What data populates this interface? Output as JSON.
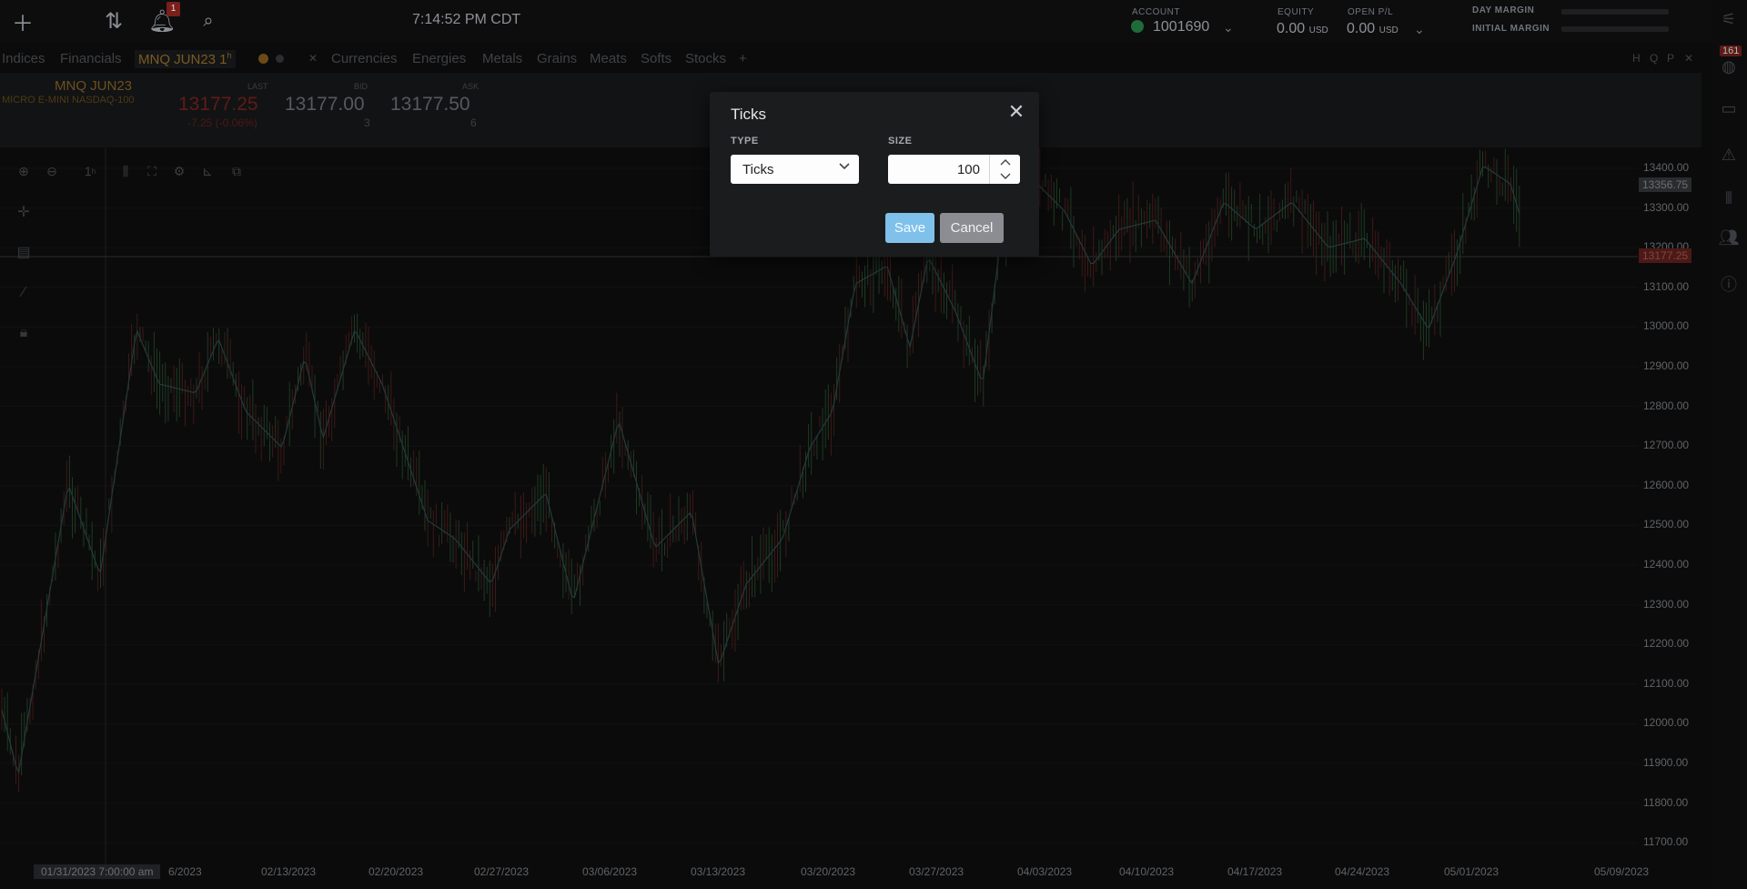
{
  "topbar": {
    "clock": "7:14:52 PM CDT",
    "notifications_count": "1",
    "account_label": "ACCOUNT",
    "account_id": "1001690",
    "equity_label": "EQUITY",
    "equity_value": "0.00",
    "equity_unit": "USD",
    "open_pl_label": "OPEN P/L",
    "open_pl_value": "0.00",
    "open_pl_unit": "USD",
    "day_margin_label": "DAY MARGIN",
    "initial_margin_label": "INITIAL MARGIN"
  },
  "tabs": [
    {
      "label": "Indices"
    },
    {
      "label": "Financials"
    },
    {
      "label": "MNQ JUN23 1"
    },
    {
      "label": "Currencies"
    },
    {
      "label": "Energies"
    },
    {
      "label": "Metals"
    },
    {
      "label": "Grains"
    },
    {
      "label": "Meats"
    },
    {
      "label": "Softs"
    },
    {
      "label": "Stocks"
    }
  ],
  "tab_superscript": "h",
  "quote": {
    "symbol": "MNQ JUN23",
    "description": "MICRO E-MINI NASDAQ-100",
    "last_label": "LAST",
    "last": "13177.25",
    "change": "-7.25 (-0.06%)",
    "bid_label": "BID",
    "bid": "13177.00",
    "bid_size": "3",
    "ask_label": "ASK",
    "ask": "13177.50",
    "ask_size": "6"
  },
  "chart_toolbar": {
    "interval": "1"
  },
  "rail": {
    "badge": "161"
  },
  "chart": {
    "y_ticks": [
      "13400.00",
      "13300.00",
      "13200.00",
      "13100.00",
      "13000.00",
      "12900.00",
      "12800.00",
      "12700.00",
      "12600.00",
      "12500.00",
      "12400.00",
      "12300.00",
      "12200.00",
      "12100.00",
      "12000.00",
      "11900.00",
      "11800.00",
      "11700.00"
    ],
    "high_tag": "13356.75",
    "last_tag": "13177.25",
    "x_ticks": [
      "6/2023",
      "02/13/2023",
      "02/20/2023",
      "02/27/2023",
      "03/06/2023",
      "03/13/2023",
      "03/20/2023",
      "03/27/2023",
      "04/03/2023",
      "04/10/2023",
      "04/17/2023",
      "04/24/2023",
      "05/01/2023",
      "05/09/2023"
    ],
    "x_cursor": "01/31/2023 7:00:00 am"
  },
  "dialog": {
    "title": "Ticks",
    "type_label": "TYPE",
    "type_value": "Ticks",
    "size_label": "SIZE",
    "size_value": "100",
    "save_label": "Save",
    "cancel_label": "Cancel"
  }
}
